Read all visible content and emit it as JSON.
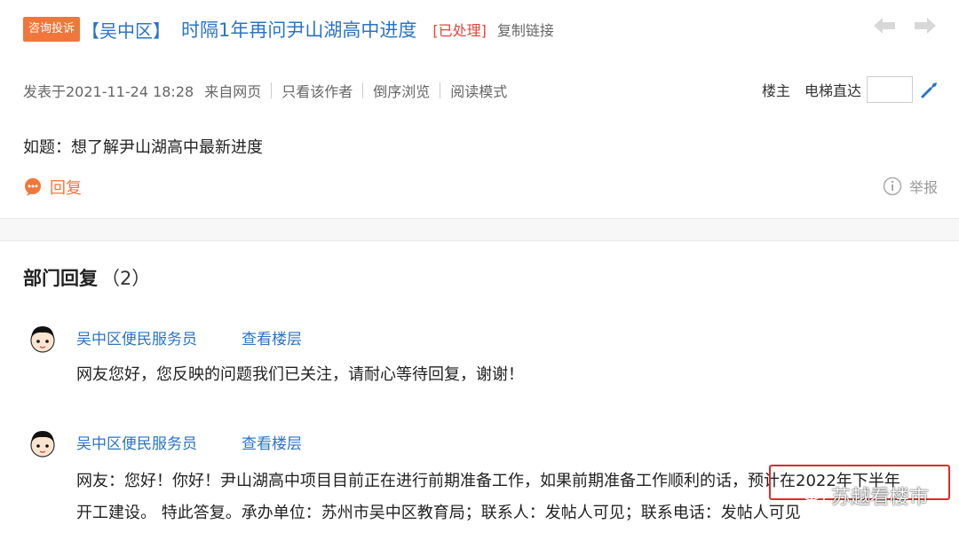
{
  "header": {
    "tag": "咨询投诉",
    "district": "【吴中区】",
    "title": "时隔1年再问尹山湖高中进度",
    "status": "[已处理]",
    "copy_link": "复制链接"
  },
  "meta": {
    "posted": "发表于2021-11-24 18:28",
    "source": "来自网页",
    "only_author": "只看该作者",
    "reverse": "倒序浏览",
    "reading_mode": "阅读模式",
    "floor_owner": "楼主",
    "elevator": "电梯直达",
    "floor_input_value": ""
  },
  "post": {
    "text": "如题：想了解尹山湖高中最新进度",
    "reply": "回复",
    "report": "举报"
  },
  "department": {
    "title": "部门回复",
    "count": "（2）",
    "replies": [
      {
        "author": "吴中区便民服务员",
        "view_floor": "查看楼层",
        "line1": "网友您好，您反映的问题我们已关注，请耐心等待回复，谢谢！"
      },
      {
        "author": "吴中区便民服务员",
        "view_floor": "查看楼层",
        "line1": "网友：您好！你好！尹山湖高中项目目前正在进行前期准备工作，如果前期准备工作顺利的话，预计在2022年下半年",
        "line2": "开工建设。 特此答复。承办单位：苏州市吴中区教育局；联系人：发帖人可见；联系电话：发帖人可见"
      }
    ]
  },
  "watermark": "苏越看楼市",
  "colors": {
    "accent_orange": "#f0763c",
    "link_blue": "#2b74c6",
    "status_red": "#e0463a",
    "highlight_red": "#e02b2b"
  }
}
